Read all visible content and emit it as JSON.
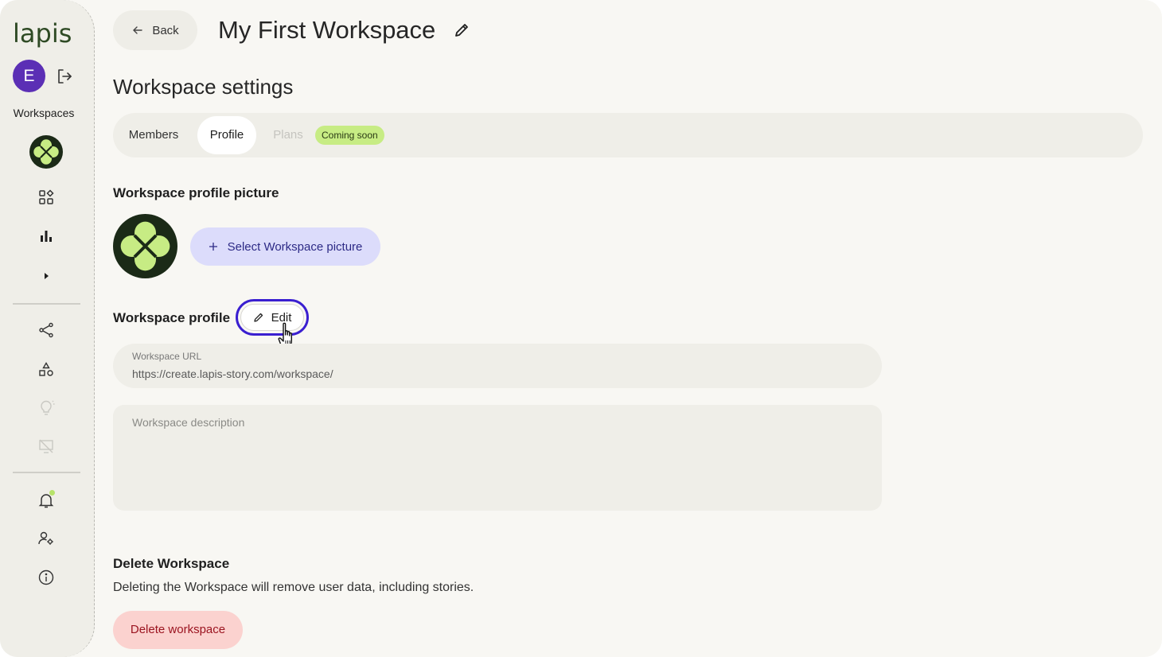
{
  "sidebar": {
    "logo_text": "lapis",
    "avatar_initial": "E",
    "section_label": "Workspaces",
    "icons": [
      "logout-icon",
      "workspace-logo-icon",
      "apps-grid-icon",
      "bar-chart-icon",
      "caret-right-icon",
      "share-icon",
      "shapes-icon",
      "lightbulb-icon",
      "presentation-off-icon",
      "bell-icon",
      "user-settings-icon",
      "info-icon"
    ]
  },
  "header": {
    "back_label": "Back",
    "workspace_title": "My First Workspace"
  },
  "page": {
    "heading": "Workspace settings"
  },
  "tabs": {
    "members": "Members",
    "profile": "Profile",
    "plans": "Plans",
    "plans_badge": "Coming soon",
    "active": "Profile"
  },
  "profile_picture": {
    "title": "Workspace profile picture",
    "select_label": "Select Workspace picture"
  },
  "workspace_profile": {
    "title": "Workspace profile",
    "edit_label": "Edit",
    "url_label": "Workspace URL",
    "url_value": "https://create.lapis-story.com/workspace/",
    "description_placeholder": "Workspace description"
  },
  "delete": {
    "title": "Delete Workspace",
    "description": "Deleting the Workspace will remove user data, including stories.",
    "button_label": "Delete workspace"
  },
  "colors": {
    "accent_green": "#c7ec84",
    "brand_dark_green": "#1b2a17",
    "avatar_purple": "#5b2fb5",
    "focus_ring": "#3a1fd0",
    "danger_bg": "#fbd2cf",
    "danger_text": "#9b1420"
  }
}
